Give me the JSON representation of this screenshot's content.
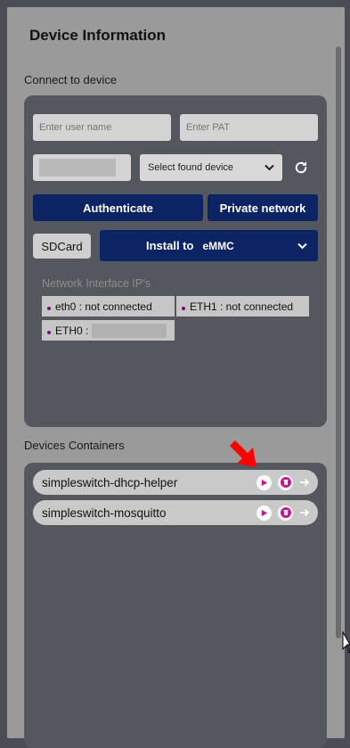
{
  "title": "Device Information",
  "connect": {
    "section_label": "Connect to device",
    "username_placeholder": "Enter user name",
    "pat_placeholder": "Enter PAT",
    "device_select": "Select found device",
    "authenticate": "Authenticate",
    "private_network": "Private network",
    "sdcard": "SDCard",
    "install_to": "Install to",
    "install_target": "eMMC",
    "network_title": "Network Interface IP's",
    "interfaces": [
      "eth0 : not connected",
      "ETH1 : not connected",
      "ETH0 :"
    ]
  },
  "containers": {
    "section_label": "Devices Containers",
    "items": [
      "simpleswitch-dhcp-helper",
      "simpleswitch-mosquitto"
    ]
  },
  "colors": {
    "accent_navy": "#0d2464",
    "action_magenta": "#c3168f",
    "annotation_red": "#ff0000"
  }
}
